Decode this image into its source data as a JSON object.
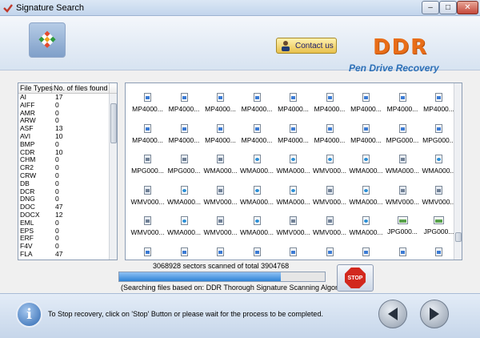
{
  "window": {
    "title": "Signature Search",
    "min": "–",
    "max": "□",
    "close": "✕"
  },
  "header": {
    "contact_label": "Contact us",
    "brand": "DDR",
    "product": "Pen Drive Recovery"
  },
  "file_types": {
    "headers": [
      "File Types",
      "No. of files found"
    ],
    "rows": [
      [
        "AI",
        "17"
      ],
      [
        "AIFF",
        "0"
      ],
      [
        "AMR",
        "0"
      ],
      [
        "ARW",
        "0"
      ],
      [
        "ASF",
        "13"
      ],
      [
        "AVI",
        "10"
      ],
      [
        "BMP",
        "0"
      ],
      [
        "CDR",
        "10"
      ],
      [
        "CHM",
        "0"
      ],
      [
        "CR2",
        "0"
      ],
      [
        "CRW",
        "0"
      ],
      [
        "DB",
        "0"
      ],
      [
        "DCR",
        "0"
      ],
      [
        "DNG",
        "0"
      ],
      [
        "DOC",
        "47"
      ],
      [
        "DOCX",
        "12"
      ],
      [
        "EML",
        "0"
      ],
      [
        "EPS",
        "0"
      ],
      [
        "ERF",
        "0"
      ],
      [
        "F4V",
        "0"
      ],
      [
        "FLA",
        "47"
      ]
    ]
  },
  "files": {
    "rows": [
      [
        [
          "mp4",
          "MP4000..."
        ],
        [
          "mp4",
          "MP4000..."
        ],
        [
          "mp4",
          "MP4000..."
        ],
        [
          "mp4",
          "MP4000..."
        ],
        [
          "mp4",
          "MP4000..."
        ],
        [
          "mp4",
          "MP4000..."
        ],
        [
          "mp4",
          "MP4000..."
        ],
        [
          "mp4",
          "MP4000..."
        ],
        [
          "mp4",
          "MP4000..."
        ]
      ],
      [
        [
          "mp4",
          "MP4000..."
        ],
        [
          "mp4",
          "MP4000..."
        ],
        [
          "mp4",
          "MP4000..."
        ],
        [
          "mp4",
          "MP4000..."
        ],
        [
          "mp4",
          "MP4000..."
        ],
        [
          "mp4",
          "MP4000..."
        ],
        [
          "mp4",
          "MP4000..."
        ],
        [
          "mp4",
          "MPG000..."
        ],
        [
          "mp4",
          "MPG000..."
        ]
      ],
      [
        [
          "wmv",
          "MPG000..."
        ],
        [
          "wmv",
          "MPG000..."
        ],
        [
          "wmv",
          "WMA000..."
        ],
        [
          "wma",
          "WMA000..."
        ],
        [
          "wma",
          "WMA000..."
        ],
        [
          "wma",
          "WMV000..."
        ],
        [
          "wma",
          "WMA000..."
        ],
        [
          "wmv",
          "WMA000..."
        ],
        [
          "wma",
          "WMA000..."
        ]
      ],
      [
        [
          "wmv",
          "WMV000..."
        ],
        [
          "wma",
          "WMA000..."
        ],
        [
          "wmv",
          "WMV000..."
        ],
        [
          "wma",
          "WMA000..."
        ],
        [
          "wma",
          "WMA000..."
        ],
        [
          "wmv",
          "WMV000..."
        ],
        [
          "wma",
          "WMA000..."
        ],
        [
          "wmv",
          "WMV000..."
        ],
        [
          "wmv",
          "WMV000..."
        ]
      ],
      [
        [
          "wmv",
          "WMV000..."
        ],
        [
          "wma",
          "WMA000..."
        ],
        [
          "wmv",
          "WMV000..."
        ],
        [
          "wma",
          "WMA000..."
        ],
        [
          "wmv",
          "WMV000..."
        ],
        [
          "wmv",
          "WMV000..."
        ],
        [
          "wma",
          "WMA000..."
        ],
        [
          "jpg",
          "JPG000..."
        ],
        [
          "jpg",
          "JPG000..."
        ]
      ],
      [
        [
          "mp4",
          ""
        ],
        [
          "mp4",
          ""
        ],
        [
          "mp4",
          ""
        ],
        [
          "mp4",
          ""
        ],
        [
          "mp4",
          ""
        ],
        [
          "mp4",
          ""
        ],
        [
          "mp4",
          ""
        ],
        [
          "mp4",
          ""
        ],
        [
          "mp4",
          ""
        ]
      ]
    ]
  },
  "progress": {
    "sectors_text": "3068928 sectors scanned of total 3904768",
    "scanned": 3068928,
    "total": 3904768,
    "algorithm_text": "(Searching files based on:  DDR Thorough Signature Scanning Algorithm)",
    "stop_label": "STOP"
  },
  "footer": {
    "message": "To Stop recovery, click on 'Stop' Button or please wait for the process to be completed.",
    "info_glyph": "i"
  }
}
